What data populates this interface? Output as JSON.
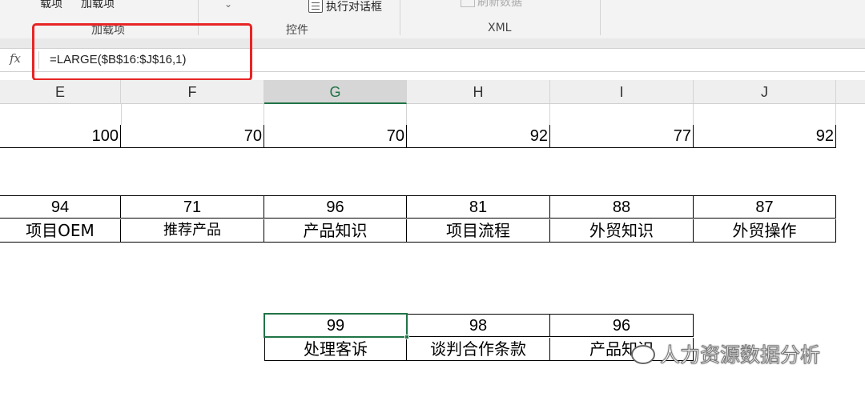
{
  "ribbon": {
    "addins_btn1": "载项",
    "addins_btn2": "加载项",
    "dialog_btn": "执行对话框",
    "refresh_btn": "刷新数据",
    "group_addins": "加载项",
    "group_controls": "控件",
    "group_xml": "XML"
  },
  "formula_bar": {
    "fx_label": "fx",
    "formula": "=LARGE($B$16:$J$16,1)"
  },
  "columns": [
    "E",
    "F",
    "G",
    "H",
    "I",
    "J"
  ],
  "selected_column": "G",
  "row1": [
    "100",
    "70",
    "70",
    "92",
    "77",
    "92"
  ],
  "table2": {
    "values": [
      "94",
      "71",
      "96",
      "81",
      "88",
      "87"
    ],
    "labels": [
      "项目OEM",
      "推荐产品",
      "产品知识",
      "项目流程",
      "外贸知识",
      "外贸操作"
    ]
  },
  "table3": {
    "values": [
      "99",
      "98",
      "96"
    ],
    "labels": [
      "处理客诉",
      "谈判合作条款",
      "产品知识"
    ]
  },
  "watermark": "人力资源数据分析",
  "colors": {
    "selection": "#217346",
    "highlight_box": "#e82424"
  }
}
